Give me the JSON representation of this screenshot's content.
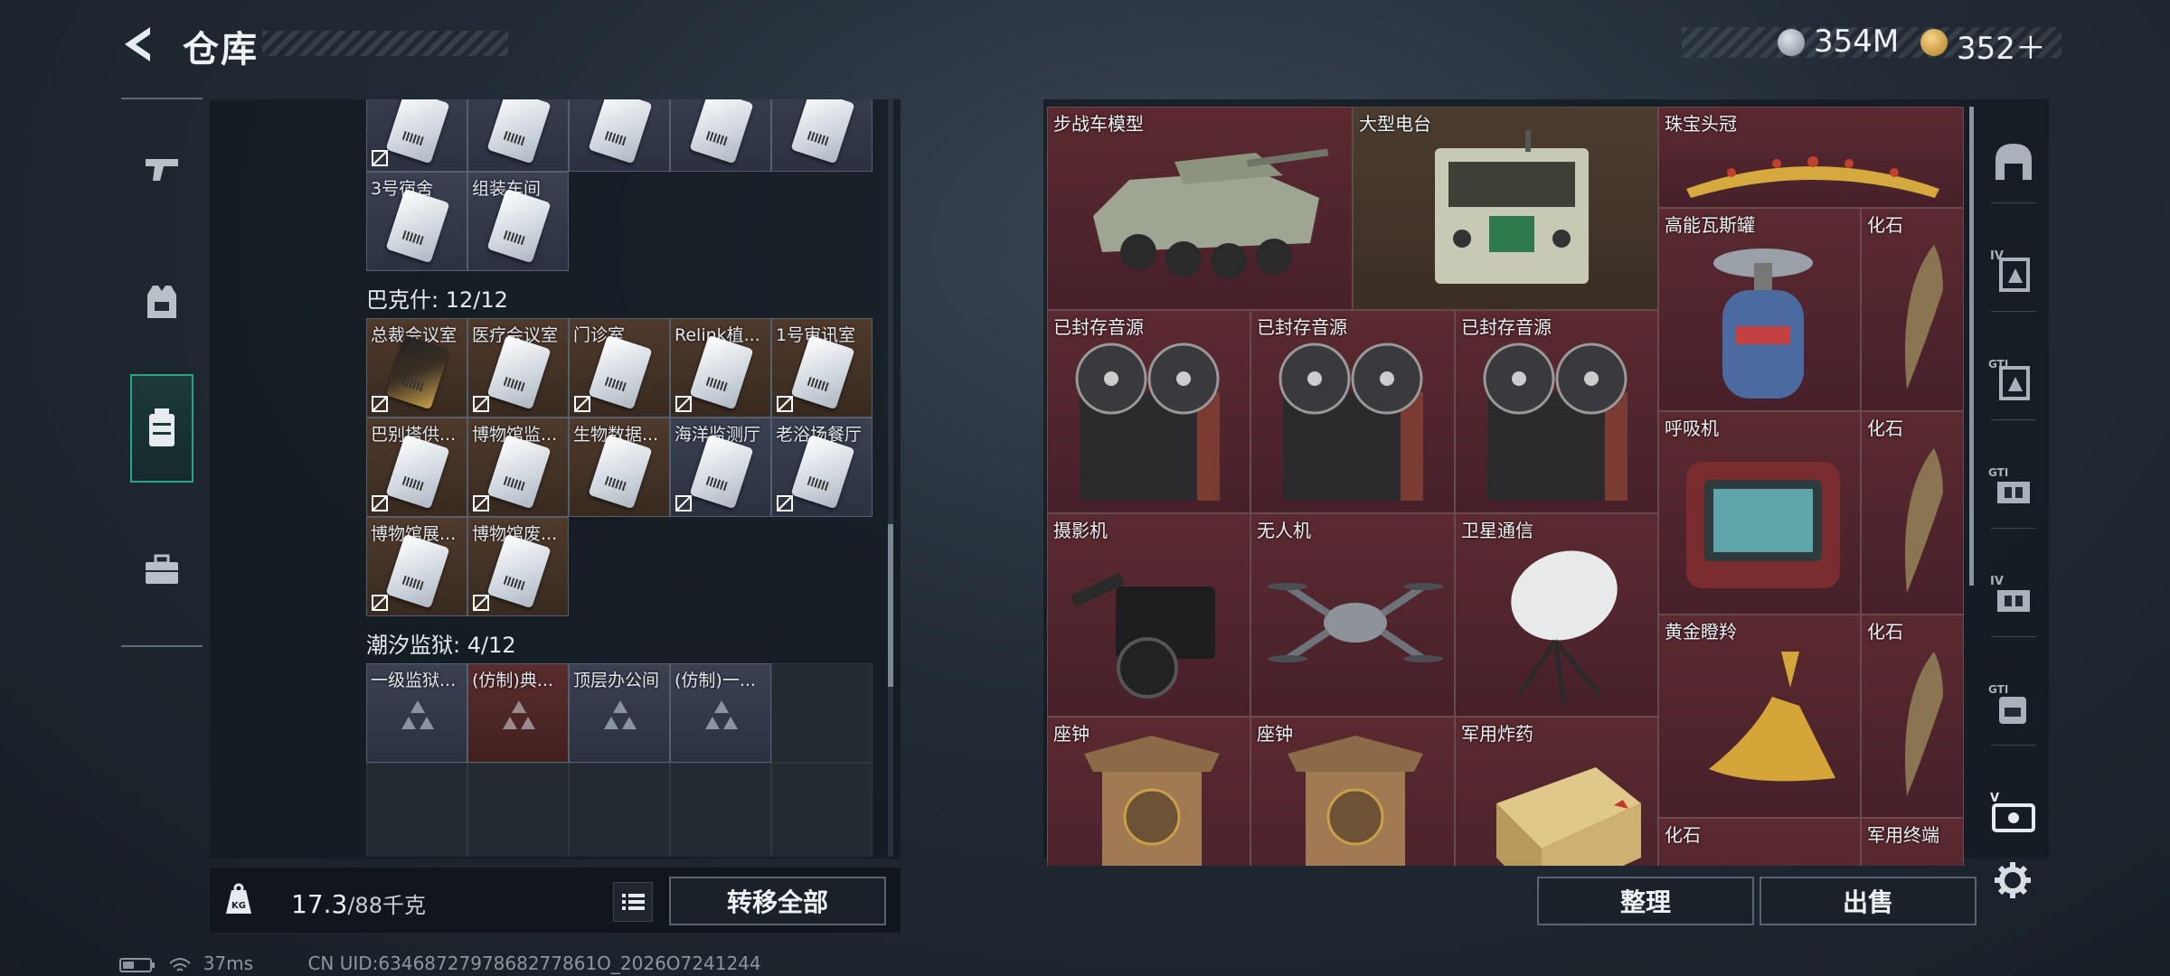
{
  "header": {
    "title": "仓库",
    "currency1": "354M",
    "currency2": "352＋"
  },
  "left_tabs": [
    {
      "name": "weapons"
    },
    {
      "name": "gear"
    },
    {
      "name": "storage"
    },
    {
      "name": "toolbox"
    }
  ],
  "keycards": {
    "top_row_labels": [
      "",
      "",
      "",
      "",
      ""
    ],
    "row2": [
      "3号宿舍",
      "组装车间"
    ],
    "group1": {
      "title": "巴克什: 12/12",
      "row1": [
        "总裁会议室",
        "医疗会议室",
        "门诊室",
        "Relink植...",
        "1号审讯室"
      ],
      "row2": [
        "巴别塔供...",
        "博物馆监...",
        "生物数据...",
        "海洋监测厅",
        "老浴场餐厅"
      ],
      "row3": [
        "博物馆展...",
        "博物馆废..."
      ]
    },
    "group2": {
      "title": "潮汐监狱: 4/12",
      "row1": [
        "一级监狱...",
        "(仿制)典...",
        "顶层办公间",
        "(仿制)一..."
      ]
    }
  },
  "weight": {
    "current": "17.3",
    "max": "/88千克"
  },
  "buttons": {
    "transfer_all": "转移全部",
    "organize": "整理",
    "sell": "出售"
  },
  "items": [
    {
      "name": "步战车模型"
    },
    {
      "name": "大型电台"
    },
    {
      "name": "珠宝头冠"
    },
    {
      "name": "高能瓦斯罐"
    },
    {
      "name": "化石"
    },
    {
      "name": "已封存音源"
    },
    {
      "name": "已封存音源"
    },
    {
      "name": "已封存音源"
    },
    {
      "name": "呼吸机"
    },
    {
      "name": "化石"
    },
    {
      "name": "摄影机"
    },
    {
      "name": "无人机"
    },
    {
      "name": "卫星通信"
    },
    {
      "name": "黄金瞪羚"
    },
    {
      "name": "化石"
    },
    {
      "name": "座钟"
    },
    {
      "name": "座钟"
    },
    {
      "name": "军用炸药"
    },
    {
      "name": "化石"
    },
    {
      "name": "军用终端"
    }
  ],
  "side_tabs": [
    "helmet",
    "armor-iv",
    "armor-gti",
    "rig-gti",
    "rig-iv",
    "backpack-gti",
    "case-v"
  ],
  "status": {
    "ping": "37ms",
    "uid": "CN UID:6346872797868277861O_2026O7241244"
  },
  "colors": {
    "accent": "#2aa388",
    "rare_red": "#5b2a30",
    "gold": "#c9a04a"
  }
}
